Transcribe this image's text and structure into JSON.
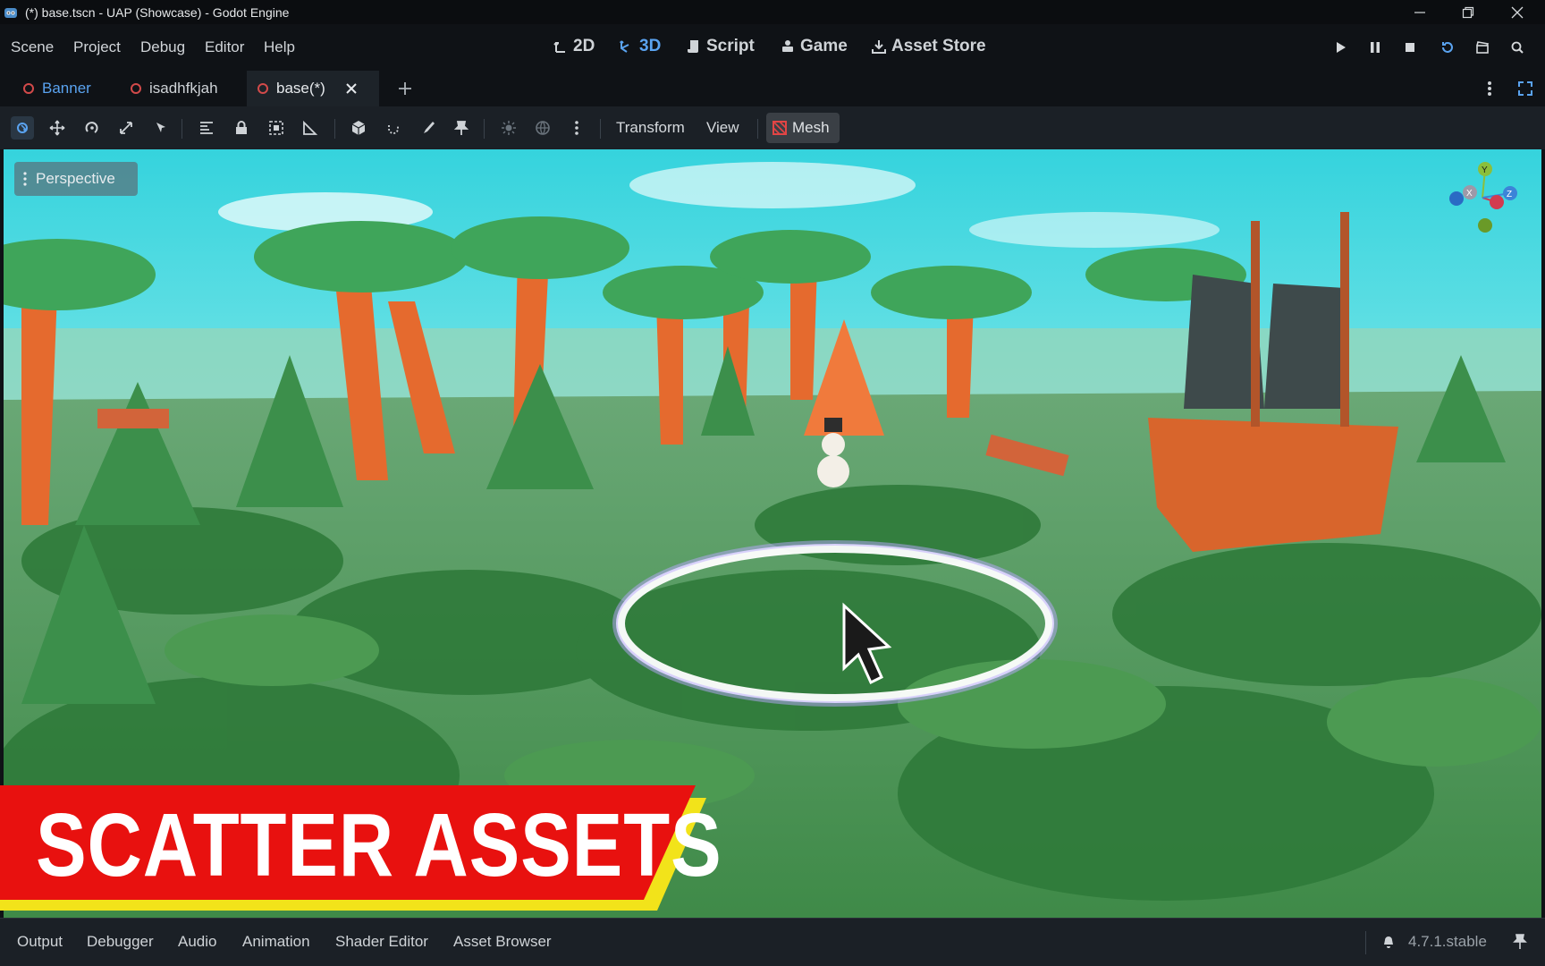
{
  "window": {
    "title": "(*) base.tscn - UAP (Showcase) - Godot Engine"
  },
  "menu": {
    "items": [
      "Scene",
      "Project",
      "Debug",
      "Editor",
      "Help"
    ]
  },
  "workspaces": {
    "items": [
      {
        "label": "2D",
        "icon": "2d-icon"
      },
      {
        "label": "3D",
        "icon": "3d-icon",
        "active": true
      },
      {
        "label": "Script",
        "icon": "script-icon"
      },
      {
        "label": "Game",
        "icon": "game-icon"
      },
      {
        "label": "Asset Store",
        "icon": "download-icon"
      }
    ]
  },
  "tabs": {
    "items": [
      {
        "label": "Banner"
      },
      {
        "label": "isadhfkjah"
      },
      {
        "label": "base(*)",
        "active": true
      }
    ]
  },
  "toolbar": {
    "transform_label": "Transform",
    "view_label": "View",
    "mesh_label": "Mesh"
  },
  "viewport": {
    "perspective_label": "Perspective",
    "gizmo": {
      "y": "Y",
      "x": "X",
      "z": "Z"
    }
  },
  "overlay": {
    "banner_text": "SCATTER ASSETS"
  },
  "bottom_panel": {
    "items": [
      "Output",
      "Debugger",
      "Audio",
      "Animation",
      "Shader Editor",
      "Asset Browser"
    ],
    "version": "4.7.1.stable"
  },
  "colors": {
    "accent": "#5aa3f0",
    "banner_red": "#e8110f",
    "banner_yellow": "#f2e31a",
    "tab_circle": "#d24a4a"
  }
}
